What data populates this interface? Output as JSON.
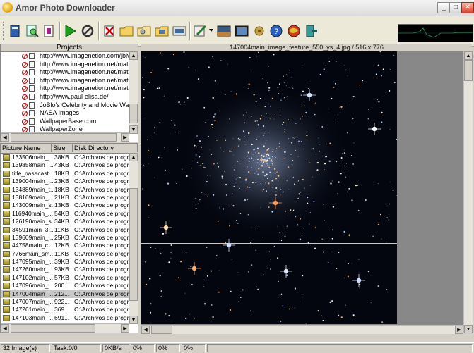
{
  "window": {
    "title": "Amor Photo Downloader",
    "min": "_",
    "max": "□",
    "close": "✕"
  },
  "toolbar": {
    "icons": [
      "book-icon",
      "search-icon",
      "document-icon",
      "play-icon",
      "stop-icon",
      "delete-icon",
      "folder-icon",
      "folder-key-icon",
      "photo-folder-icon",
      "slideshow-icon",
      "edit-icon",
      "dropdown-icon",
      "image-icon",
      "gallery-icon",
      "settings-icon",
      "help-icon",
      "globe-icon",
      "exit-icon"
    ]
  },
  "projects": {
    "header": "Projects",
    "items": [
      "http://www.imagenetion.com/jbivision",
      "http://www.imagenetion.net/matrix/bv",
      "http://www.imagenetion.net/matrix/jbl",
      "http://www.imagenetion.net/matrix/jbl",
      "http://www.imagenetion.net/matrix/jbl",
      "http://www.paul-elisa.de/",
      "JoBlo's Celebrity and Movie Wallpaper",
      "NASA Images",
      "WallpaperBase.com",
      "WallpaperZone"
    ]
  },
  "files": {
    "columns": [
      "Picture Name",
      "Size",
      "Disk Directory"
    ],
    "rows": [
      [
        "133506main_...",
        "38KB",
        "C:\\Archivos de progr..."
      ],
      [
        "139858main_...",
        "43KB",
        "C:\\Archivos de progr..."
      ],
      [
        "title_nasacast...",
        "18KB",
        "C:\\Archivos de progr..."
      ],
      [
        "139004main_...",
        "23KB",
        "C:\\Archivos de progr..."
      ],
      [
        "134889main_t...",
        "18KB",
        "C:\\Archivos de progr..."
      ],
      [
        "138169main_...",
        "21KB",
        "C:\\Archivos de progr..."
      ],
      [
        "143009main_s...",
        "13KB",
        "C:\\Archivos de progr..."
      ],
      [
        "116940main_...",
        "54KB",
        "C:\\Archivos de progr..."
      ],
      [
        "126190main_s...",
        "34KB",
        "C:\\Archivos de progr..."
      ],
      [
        "34591main_3...",
        "11KB",
        "C:\\Archivos de progr..."
      ],
      [
        "139609main_...",
        "25KB",
        "C:\\Archivos de progr..."
      ],
      [
        "44758main_c...",
        "12KB",
        "C:\\Archivos de progr..."
      ],
      [
        "7766main_sm...",
        "11KB",
        "C:\\Archivos de progr..."
      ],
      [
        "147095main_i...",
        "39KB",
        "C:\\Archivos de progr..."
      ],
      [
        "147260main_i...",
        "93KB",
        "C:\\Archivos de progr..."
      ],
      [
        "147102main_i...",
        "57KB",
        "C:\\Archivos de progr..."
      ],
      [
        "147096main_i...",
        "200...",
        "C:\\Archivos de progr..."
      ],
      [
        "147004main_i...",
        "212...",
        "C:\\Archivos de progr..."
      ],
      [
        "147007main_i...",
        "922...",
        "C:\\Archivos de progr..."
      ],
      [
        "147261main_i...",
        "369...",
        "C:\\Archivos de progr..."
      ],
      [
        "147103main_i...",
        "691...",
        "C:\\Archivos de progr..."
      ]
    ],
    "selected_index": 17
  },
  "image_header": "147004main_image_feature_550_ys_4.jpg / 516 x 776",
  "status": {
    "images": "32 Image(s)",
    "task": "Task:0/0",
    "speed": "0KB/s",
    "p1": "0%",
    "p2": "0%",
    "p3": "0%"
  }
}
